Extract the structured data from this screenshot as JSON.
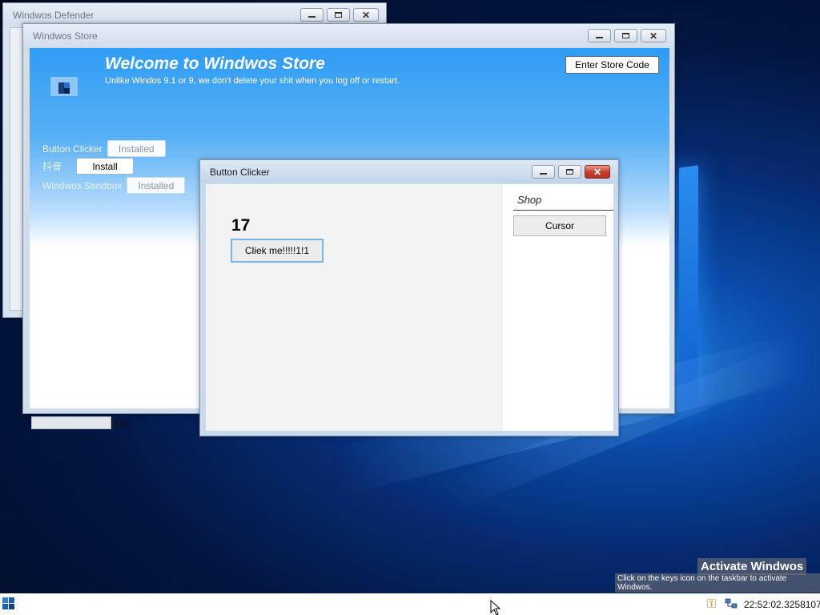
{
  "desktop": {
    "activation": {
      "title": "Activate Windwos",
      "subtitle": "Click on the keys icon on the taskbar to activate Windwos."
    }
  },
  "defender_window": {
    "title": "Windwos Defender"
  },
  "store_window": {
    "title": "Windwos Store",
    "heading": "Welcome to Windwos Store",
    "subheading": "Unlike Windos 9.1 or 9, we don't delete your shit when you log off or restart.",
    "store_code_button": "Enter Store Code",
    "apps": [
      {
        "name": "Button Clicker",
        "action": "Installed"
      },
      {
        "name": "抖音",
        "action": "Install"
      },
      {
        "name": "Windwos Sandbox",
        "action": "Installed"
      }
    ],
    "status": "Idle"
  },
  "clicker_window": {
    "title": "Button Clicker",
    "count": "17",
    "click_button": "Cliek me!!!!!1!1",
    "shop_label": "Shop",
    "shop_items": [
      "Cursor"
    ]
  },
  "taskbar": {
    "clock": "22:52:02.3258107"
  },
  "colors": {
    "accent_blue": "#2f9cf5",
    "close_red": "#c7432f",
    "taskbar": "#ffffff"
  }
}
